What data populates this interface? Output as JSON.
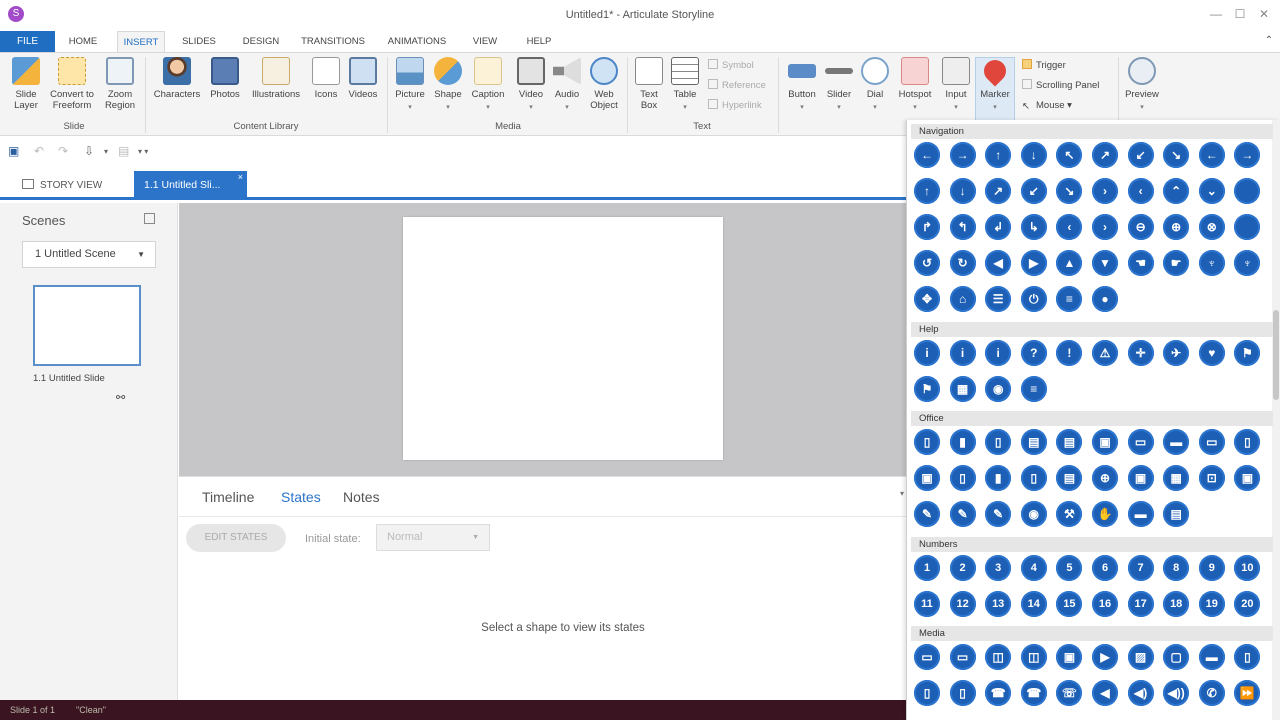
{
  "window": {
    "title": "Untitled1* - Articulate Storyline",
    "logo_icon": "storyline-logo-icon",
    "controls": [
      "—",
      "☐",
      "✕"
    ]
  },
  "menu": {
    "file": "FILE",
    "tabs": [
      "HOME",
      "INSERT",
      "SLIDES",
      "DESIGN",
      "TRANSITIONS",
      "ANIMATIONS",
      "VIEW",
      "HELP"
    ],
    "active_tab": "INSERT"
  },
  "ribbon": {
    "slide_group": {
      "label": "Slide",
      "buttons": [
        {
          "label": "Slide\nLayer",
          "icon": "slide-layer-icon"
        },
        {
          "label": "Convert to\nFreeform",
          "icon": "convert-freeform-icon"
        },
        {
          "label": "Zoom\nRegion",
          "icon": "zoom-region-icon"
        }
      ]
    },
    "content_library_group": {
      "label": "Content Library",
      "buttons": [
        {
          "label": "Characters",
          "icon": "characters-icon"
        },
        {
          "label": "Photos",
          "icon": "photos-icon"
        },
        {
          "label": "Illustrations",
          "icon": "illustrations-icon"
        },
        {
          "label": "Icons",
          "icon": "icons-icon"
        },
        {
          "label": "Videos",
          "icon": "videos-icon"
        }
      ]
    },
    "media_group": {
      "label": "Media",
      "buttons": [
        {
          "label": "Picture",
          "icon": "picture-icon"
        },
        {
          "label": "Shape",
          "icon": "shape-icon"
        },
        {
          "label": "Caption",
          "icon": "caption-icon"
        },
        {
          "label": "Video",
          "icon": "video-icon"
        },
        {
          "label": "Audio",
          "icon": "audio-icon"
        },
        {
          "label": "Web\nObject",
          "icon": "web-object-icon"
        }
      ]
    },
    "text_group": {
      "label": "Text",
      "buttons": [
        {
          "label": "Text\nBox",
          "icon": "text-box-icon"
        },
        {
          "label": "Table",
          "icon": "table-icon"
        }
      ],
      "small": [
        "Symbol",
        "Reference",
        "Hyperlink"
      ]
    },
    "interactive_group": {
      "buttons": [
        {
          "label": "Button",
          "icon": "button-icon"
        },
        {
          "label": "Slider",
          "icon": "slider-icon"
        },
        {
          "label": "Dial",
          "icon": "dial-icon"
        },
        {
          "label": "Hotspot",
          "icon": "hotspot-icon"
        },
        {
          "label": "Input",
          "icon": "input-icon"
        },
        {
          "label": "Marker",
          "icon": "marker-icon"
        }
      ],
      "small": [
        "Trigger",
        "Scrolling Panel",
        "Mouse"
      ]
    },
    "preview": {
      "label": "Preview",
      "icon": "preview-icon"
    }
  },
  "view_tabs": {
    "story_view": "STORY VIEW",
    "slide_tab": "1.1 Untitled Sli..."
  },
  "scenes_panel": {
    "title": "Scenes",
    "selected_scene": "1 Untitled Scene",
    "slide_label": "1.1 Untitled Slide"
  },
  "bottom_panel": {
    "tabs": [
      "Timeline",
      "States",
      "Notes"
    ],
    "active_tab": "States",
    "edit_states": "EDIT STATES",
    "initial_state_label": "Initial state:",
    "initial_state_value": "Normal",
    "message": "Select a shape to view its states"
  },
  "status_bar": {
    "slide": "Slide 1 of 1",
    "theme": "\"Clean\""
  },
  "marker_gallery": {
    "sections": [
      {
        "title": "Navigation",
        "items": [
          "←",
          "→",
          "↑",
          "↓",
          "↖",
          "↗",
          "↙",
          "↘",
          "←",
          "→",
          "↑",
          "↓",
          "↗",
          "↙",
          "↘",
          "›",
          "‹",
          "⌃",
          "⌄",
          "",
          "↱",
          "↰",
          "↲",
          "↳",
          "‹",
          "›",
          "⊖",
          "⊕",
          "⊗",
          "",
          "↺",
          "↻",
          "◀",
          "▶",
          "▲",
          "▼",
          "☚",
          "☛",
          "♆",
          "♆",
          "✥",
          "⌂",
          "☰",
          "⏻",
          "≡",
          "●"
        ]
      },
      {
        "title": "Help",
        "items": [
          "i",
          "i",
          "i",
          "?",
          "!",
          "⚠",
          "✛",
          "✈",
          "♥",
          "⚑",
          "⚑",
          "▦",
          "◉",
          "≡"
        ]
      },
      {
        "title": "Office",
        "items": [
          "▯",
          "▮",
          "▯",
          "▤",
          "▤",
          "▣",
          "▭",
          "▬",
          "▭",
          "▯",
          "▣",
          "▯",
          "▮",
          "▯",
          "▤",
          "⊕",
          "▣",
          "▦",
          "⊡",
          "▣",
          "✎",
          "✎",
          "✎",
          "◉",
          "⚒",
          "✋",
          "▬",
          "▤"
        ]
      },
      {
        "title": "Numbers",
        "items": [
          "1",
          "2",
          "3",
          "4",
          "5",
          "6",
          "7",
          "8",
          "9",
          "10",
          "11",
          "12",
          "13",
          "14",
          "15",
          "16",
          "17",
          "18",
          "19",
          "20"
        ]
      },
      {
        "title": "Media",
        "items": [
          "▭",
          "▭",
          "◫",
          "◫",
          "▣",
          "▶",
          "▨",
          "▢",
          "▬",
          "▯",
          "▯",
          "▯",
          "☎",
          "☎",
          "☏",
          "◀",
          "◀)",
          "◀))",
          "✆",
          "⏩"
        ]
      }
    ]
  },
  "colors": {
    "accent": "#1f6ec2",
    "marker_fill": "#1c5fb5",
    "status_bar": "#3a1420"
  }
}
